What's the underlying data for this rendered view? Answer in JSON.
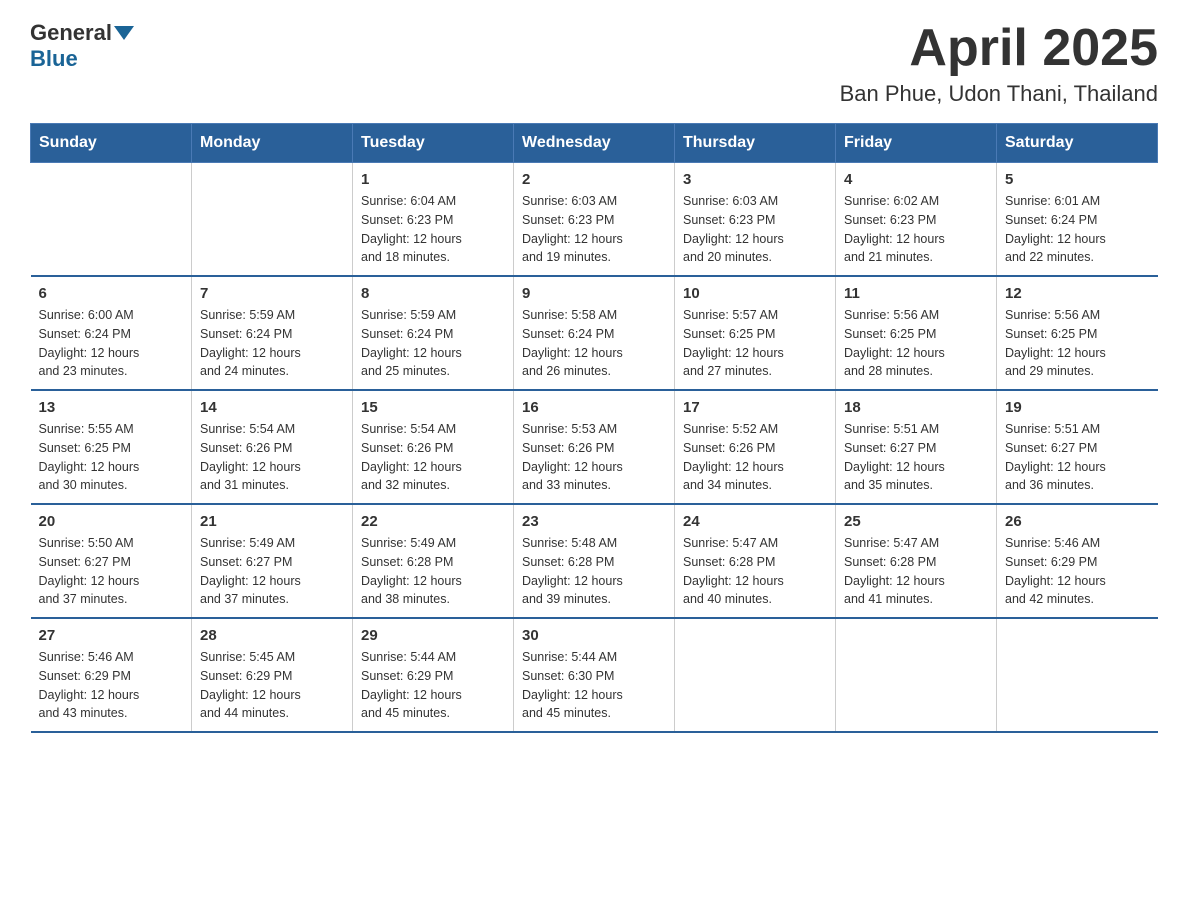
{
  "header": {
    "logo_general": "General",
    "logo_blue": "Blue",
    "month_title": "April 2025",
    "location": "Ban Phue, Udon Thani, Thailand"
  },
  "columns": [
    "Sunday",
    "Monday",
    "Tuesday",
    "Wednesday",
    "Thursday",
    "Friday",
    "Saturday"
  ],
  "weeks": [
    [
      {
        "day": "",
        "info": ""
      },
      {
        "day": "",
        "info": ""
      },
      {
        "day": "1",
        "info": "Sunrise: 6:04 AM\nSunset: 6:23 PM\nDaylight: 12 hours\nand 18 minutes."
      },
      {
        "day": "2",
        "info": "Sunrise: 6:03 AM\nSunset: 6:23 PM\nDaylight: 12 hours\nand 19 minutes."
      },
      {
        "day": "3",
        "info": "Sunrise: 6:03 AM\nSunset: 6:23 PM\nDaylight: 12 hours\nand 20 minutes."
      },
      {
        "day": "4",
        "info": "Sunrise: 6:02 AM\nSunset: 6:23 PM\nDaylight: 12 hours\nand 21 minutes."
      },
      {
        "day": "5",
        "info": "Sunrise: 6:01 AM\nSunset: 6:24 PM\nDaylight: 12 hours\nand 22 minutes."
      }
    ],
    [
      {
        "day": "6",
        "info": "Sunrise: 6:00 AM\nSunset: 6:24 PM\nDaylight: 12 hours\nand 23 minutes."
      },
      {
        "day": "7",
        "info": "Sunrise: 5:59 AM\nSunset: 6:24 PM\nDaylight: 12 hours\nand 24 minutes."
      },
      {
        "day": "8",
        "info": "Sunrise: 5:59 AM\nSunset: 6:24 PM\nDaylight: 12 hours\nand 25 minutes."
      },
      {
        "day": "9",
        "info": "Sunrise: 5:58 AM\nSunset: 6:24 PM\nDaylight: 12 hours\nand 26 minutes."
      },
      {
        "day": "10",
        "info": "Sunrise: 5:57 AM\nSunset: 6:25 PM\nDaylight: 12 hours\nand 27 minutes."
      },
      {
        "day": "11",
        "info": "Sunrise: 5:56 AM\nSunset: 6:25 PM\nDaylight: 12 hours\nand 28 minutes."
      },
      {
        "day": "12",
        "info": "Sunrise: 5:56 AM\nSunset: 6:25 PM\nDaylight: 12 hours\nand 29 minutes."
      }
    ],
    [
      {
        "day": "13",
        "info": "Sunrise: 5:55 AM\nSunset: 6:25 PM\nDaylight: 12 hours\nand 30 minutes."
      },
      {
        "day": "14",
        "info": "Sunrise: 5:54 AM\nSunset: 6:26 PM\nDaylight: 12 hours\nand 31 minutes."
      },
      {
        "day": "15",
        "info": "Sunrise: 5:54 AM\nSunset: 6:26 PM\nDaylight: 12 hours\nand 32 minutes."
      },
      {
        "day": "16",
        "info": "Sunrise: 5:53 AM\nSunset: 6:26 PM\nDaylight: 12 hours\nand 33 minutes."
      },
      {
        "day": "17",
        "info": "Sunrise: 5:52 AM\nSunset: 6:26 PM\nDaylight: 12 hours\nand 34 minutes."
      },
      {
        "day": "18",
        "info": "Sunrise: 5:51 AM\nSunset: 6:27 PM\nDaylight: 12 hours\nand 35 minutes."
      },
      {
        "day": "19",
        "info": "Sunrise: 5:51 AM\nSunset: 6:27 PM\nDaylight: 12 hours\nand 36 minutes."
      }
    ],
    [
      {
        "day": "20",
        "info": "Sunrise: 5:50 AM\nSunset: 6:27 PM\nDaylight: 12 hours\nand 37 minutes."
      },
      {
        "day": "21",
        "info": "Sunrise: 5:49 AM\nSunset: 6:27 PM\nDaylight: 12 hours\nand 37 minutes."
      },
      {
        "day": "22",
        "info": "Sunrise: 5:49 AM\nSunset: 6:28 PM\nDaylight: 12 hours\nand 38 minutes."
      },
      {
        "day": "23",
        "info": "Sunrise: 5:48 AM\nSunset: 6:28 PM\nDaylight: 12 hours\nand 39 minutes."
      },
      {
        "day": "24",
        "info": "Sunrise: 5:47 AM\nSunset: 6:28 PM\nDaylight: 12 hours\nand 40 minutes."
      },
      {
        "day": "25",
        "info": "Sunrise: 5:47 AM\nSunset: 6:28 PM\nDaylight: 12 hours\nand 41 minutes."
      },
      {
        "day": "26",
        "info": "Sunrise: 5:46 AM\nSunset: 6:29 PM\nDaylight: 12 hours\nand 42 minutes."
      }
    ],
    [
      {
        "day": "27",
        "info": "Sunrise: 5:46 AM\nSunset: 6:29 PM\nDaylight: 12 hours\nand 43 minutes."
      },
      {
        "day": "28",
        "info": "Sunrise: 5:45 AM\nSunset: 6:29 PM\nDaylight: 12 hours\nand 44 minutes."
      },
      {
        "day": "29",
        "info": "Sunrise: 5:44 AM\nSunset: 6:29 PM\nDaylight: 12 hours\nand 45 minutes."
      },
      {
        "day": "30",
        "info": "Sunrise: 5:44 AM\nSunset: 6:30 PM\nDaylight: 12 hours\nand 45 minutes."
      },
      {
        "day": "",
        "info": ""
      },
      {
        "day": "",
        "info": ""
      },
      {
        "day": "",
        "info": ""
      }
    ]
  ]
}
